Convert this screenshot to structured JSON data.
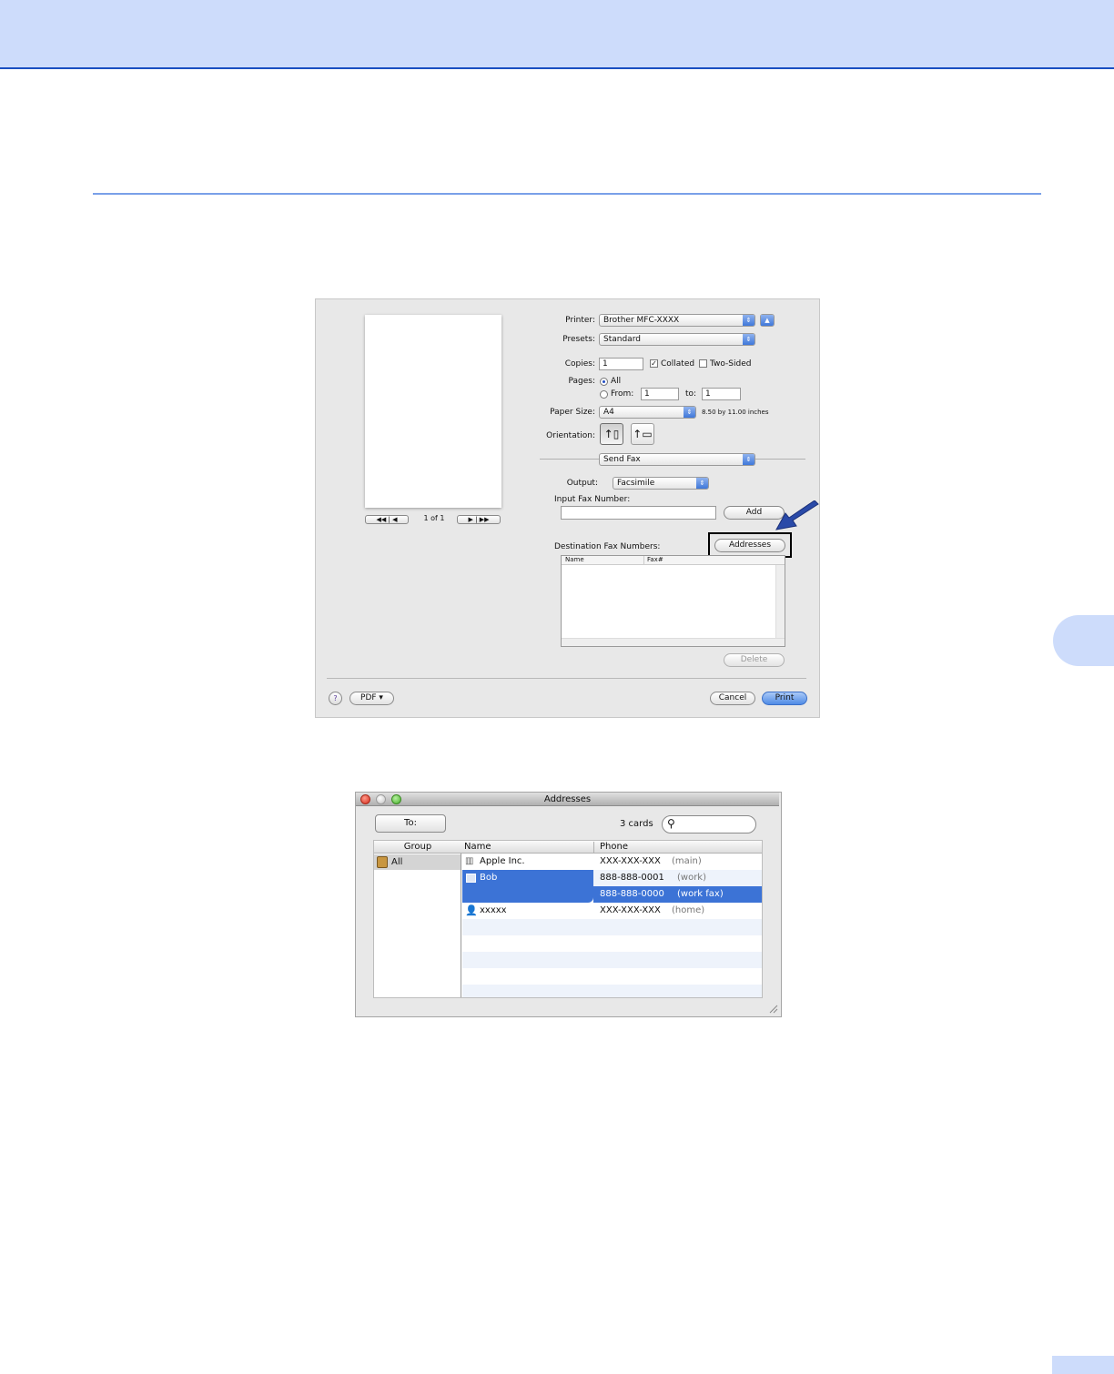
{
  "print_dialog": {
    "printer_label": "Printer:",
    "printer_value": "Brother MFC-XXXX",
    "presets_label": "Presets:",
    "presets_value": "Standard",
    "copies_label": "Copies:",
    "copies_value": "1",
    "collated_label": "Collated",
    "two_sided_label": "Two-Sided",
    "pages_label": "Pages:",
    "pages_all_label": "All",
    "pages_from_label": "From:",
    "pages_from_value": "1",
    "pages_to_label": "to:",
    "pages_to_value": "1",
    "paper_size_label": "Paper Size:",
    "paper_size_value": "A4",
    "paper_size_dims": "8.50 by 11.00 inches",
    "orientation_label": "Orientation:",
    "section_popup": "Send Fax",
    "output_label": "Output:",
    "output_value": "Facsimile",
    "input_fax_label": "Input Fax Number:",
    "input_fax_value": "",
    "add_button": "Add",
    "addresses_button": "Addresses",
    "destination_label": "Destination Fax Numbers:",
    "dest_col_name": "Name",
    "dest_col_fax": "Fax#",
    "delete_button": "Delete",
    "preview_page_text": "1 of 1",
    "help_icon": "?",
    "pdf_button": "PDF ▾",
    "cancel_button": "Cancel",
    "print_button": "Print"
  },
  "addresses_window": {
    "title": "Addresses",
    "to_button": "To:",
    "card_count": "3 cards",
    "search_placeholder": "",
    "col_group": "Group",
    "col_name": "Name",
    "col_phone": "Phone",
    "groups": [
      {
        "label": "All"
      }
    ],
    "contacts": [
      {
        "name": "Apple Inc.",
        "phone": "XXX-XXX-XXX",
        "phone_type": "(main)"
      },
      {
        "name": "Bob",
        "phone": "888-888-0001",
        "phone_type": "(work)"
      },
      {
        "name": "",
        "phone": "888-888-0000",
        "phone_type": "(work fax)"
      },
      {
        "name": "xxxxx",
        "phone": "XXX-XXX-XXX",
        "phone_type": "(home)"
      }
    ]
  },
  "colors": {
    "banner": "#cddcfb",
    "banner_border": "#1a4fc1",
    "selection": "#3c73d6",
    "arrow": "#2a4aa8"
  }
}
